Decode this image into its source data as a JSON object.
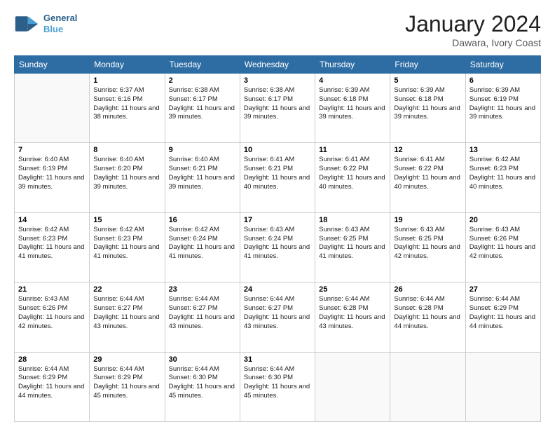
{
  "header": {
    "logo_general": "General",
    "logo_blue": "Blue",
    "month_title": "January 2024",
    "location": "Dawara, Ivory Coast"
  },
  "days_of_week": [
    "Sunday",
    "Monday",
    "Tuesday",
    "Wednesday",
    "Thursday",
    "Friday",
    "Saturday"
  ],
  "weeks": [
    [
      {
        "day": "",
        "empty": true
      },
      {
        "day": "1",
        "sunrise": "6:37 AM",
        "sunset": "6:16 PM",
        "daylight": "11 hours and 38 minutes."
      },
      {
        "day": "2",
        "sunrise": "6:38 AM",
        "sunset": "6:17 PM",
        "daylight": "11 hours and 39 minutes."
      },
      {
        "day": "3",
        "sunrise": "6:38 AM",
        "sunset": "6:17 PM",
        "daylight": "11 hours and 39 minutes."
      },
      {
        "day": "4",
        "sunrise": "6:39 AM",
        "sunset": "6:18 PM",
        "daylight": "11 hours and 39 minutes."
      },
      {
        "day": "5",
        "sunrise": "6:39 AM",
        "sunset": "6:18 PM",
        "daylight": "11 hours and 39 minutes."
      },
      {
        "day": "6",
        "sunrise": "6:39 AM",
        "sunset": "6:19 PM",
        "daylight": "11 hours and 39 minutes."
      }
    ],
    [
      {
        "day": "7",
        "sunrise": "6:40 AM",
        "sunset": "6:19 PM",
        "daylight": "11 hours and 39 minutes."
      },
      {
        "day": "8",
        "sunrise": "6:40 AM",
        "sunset": "6:20 PM",
        "daylight": "11 hours and 39 minutes."
      },
      {
        "day": "9",
        "sunrise": "6:40 AM",
        "sunset": "6:21 PM",
        "daylight": "11 hours and 39 minutes."
      },
      {
        "day": "10",
        "sunrise": "6:41 AM",
        "sunset": "6:21 PM",
        "daylight": "11 hours and 40 minutes."
      },
      {
        "day": "11",
        "sunrise": "6:41 AM",
        "sunset": "6:22 PM",
        "daylight": "11 hours and 40 minutes."
      },
      {
        "day": "12",
        "sunrise": "6:41 AM",
        "sunset": "6:22 PM",
        "daylight": "11 hours and 40 minutes."
      },
      {
        "day": "13",
        "sunrise": "6:42 AM",
        "sunset": "6:23 PM",
        "daylight": "11 hours and 40 minutes."
      }
    ],
    [
      {
        "day": "14",
        "sunrise": "6:42 AM",
        "sunset": "6:23 PM",
        "daylight": "11 hours and 41 minutes."
      },
      {
        "day": "15",
        "sunrise": "6:42 AM",
        "sunset": "6:23 PM",
        "daylight": "11 hours and 41 minutes."
      },
      {
        "day": "16",
        "sunrise": "6:42 AM",
        "sunset": "6:24 PM",
        "daylight": "11 hours and 41 minutes."
      },
      {
        "day": "17",
        "sunrise": "6:43 AM",
        "sunset": "6:24 PM",
        "daylight": "11 hours and 41 minutes."
      },
      {
        "day": "18",
        "sunrise": "6:43 AM",
        "sunset": "6:25 PM",
        "daylight": "11 hours and 41 minutes."
      },
      {
        "day": "19",
        "sunrise": "6:43 AM",
        "sunset": "6:25 PM",
        "daylight": "11 hours and 42 minutes."
      },
      {
        "day": "20",
        "sunrise": "6:43 AM",
        "sunset": "6:26 PM",
        "daylight": "11 hours and 42 minutes."
      }
    ],
    [
      {
        "day": "21",
        "sunrise": "6:43 AM",
        "sunset": "6:26 PM",
        "daylight": "11 hours and 42 minutes."
      },
      {
        "day": "22",
        "sunrise": "6:44 AM",
        "sunset": "6:27 PM",
        "daylight": "11 hours and 43 minutes."
      },
      {
        "day": "23",
        "sunrise": "6:44 AM",
        "sunset": "6:27 PM",
        "daylight": "11 hours and 43 minutes."
      },
      {
        "day": "24",
        "sunrise": "6:44 AM",
        "sunset": "6:27 PM",
        "daylight": "11 hours and 43 minutes."
      },
      {
        "day": "25",
        "sunrise": "6:44 AM",
        "sunset": "6:28 PM",
        "daylight": "11 hours and 43 minutes."
      },
      {
        "day": "26",
        "sunrise": "6:44 AM",
        "sunset": "6:28 PM",
        "daylight": "11 hours and 44 minutes."
      },
      {
        "day": "27",
        "sunrise": "6:44 AM",
        "sunset": "6:29 PM",
        "daylight": "11 hours and 44 minutes."
      }
    ],
    [
      {
        "day": "28",
        "sunrise": "6:44 AM",
        "sunset": "6:29 PM",
        "daylight": "11 hours and 44 minutes."
      },
      {
        "day": "29",
        "sunrise": "6:44 AM",
        "sunset": "6:29 PM",
        "daylight": "11 hours and 45 minutes."
      },
      {
        "day": "30",
        "sunrise": "6:44 AM",
        "sunset": "6:30 PM",
        "daylight": "11 hours and 45 minutes."
      },
      {
        "day": "31",
        "sunrise": "6:44 AM",
        "sunset": "6:30 PM",
        "daylight": "11 hours and 45 minutes."
      },
      {
        "day": "",
        "empty": true
      },
      {
        "day": "",
        "empty": true
      },
      {
        "day": "",
        "empty": true
      }
    ]
  ]
}
